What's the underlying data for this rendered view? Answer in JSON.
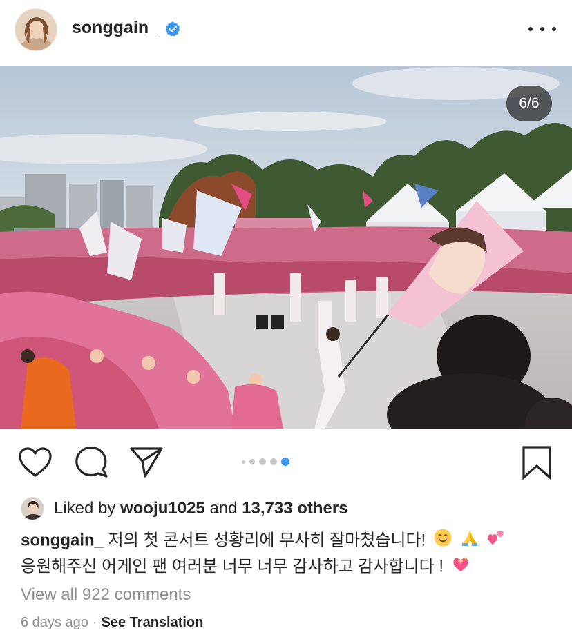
{
  "post": {
    "username": "songgain_",
    "verified": true,
    "more_icon": "more-horizontal-icon",
    "media_counter": "6/6",
    "carousel": {
      "count": 5,
      "active_index": 4
    }
  },
  "actions": {
    "like_icon": "heart-icon",
    "comment_icon": "comment-icon",
    "share_icon": "send-icon",
    "save_icon": "bookmark-icon"
  },
  "likes": {
    "prefix": "Liked by ",
    "liker": "wooju1025",
    "middle": " and ",
    "others": "13,733 others"
  },
  "caption": {
    "author": "songgain_",
    "line1": " 저의 첫 콘서트 성황리에 무사히 잘마쳤습니다!",
    "line2": "응원해주신 어게인 팬 여러분 너무 너무 감사하고 감사합니다 !",
    "emojis": [
      "smiling-face",
      "folded-hands",
      "two-hearts",
      "sparkling-heart"
    ]
  },
  "comments": {
    "view_all": "View all 922 comments"
  },
  "meta": {
    "time_ago": "6 days ago",
    "separator": "·",
    "translate": "See Translation"
  },
  "colors": {
    "accent_blue": "#3897f0",
    "text": "#262626",
    "muted": "#8e8e8e",
    "verified": "#3897f0"
  }
}
